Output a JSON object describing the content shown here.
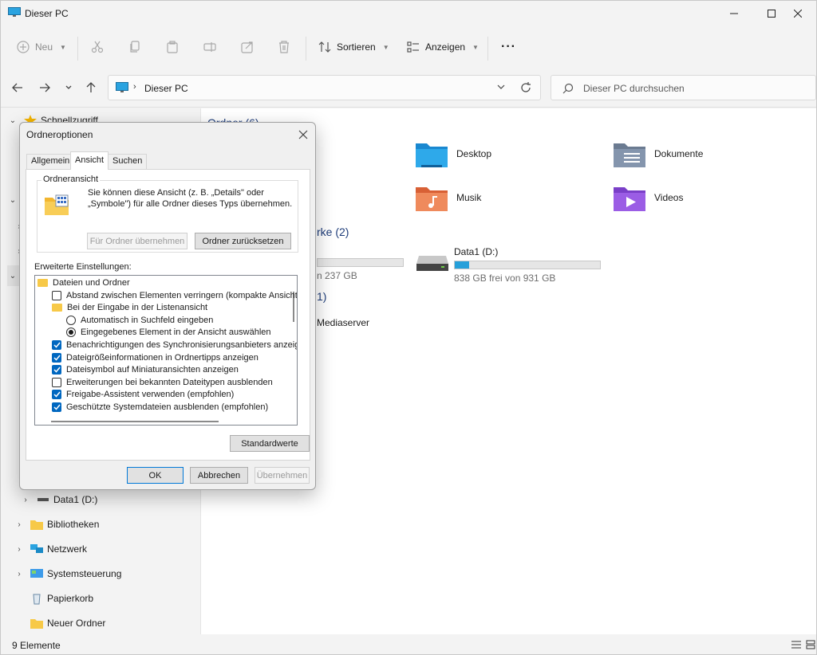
{
  "window": {
    "title": "Dieser PC"
  },
  "toolbar": {
    "new_label": "Neu",
    "sort_label": "Sortieren",
    "view_label": "Anzeigen"
  },
  "nav": {
    "address": "Dieser PC",
    "search_placeholder": "Dieser PC durchsuchen"
  },
  "sidebar": {
    "quick_access": "Schnellzugriff",
    "items": [
      {
        "label": "Data1 (D:)"
      },
      {
        "label": "Bibliotheken"
      },
      {
        "label": "Netzwerk"
      },
      {
        "label": "Systemsteuerung"
      },
      {
        "label": "Papierkorb"
      },
      {
        "label": "Neuer Ordner"
      }
    ]
  },
  "main": {
    "folders_header": "Ordner (6)",
    "folders": [
      {
        "label": "Desktop",
        "icon": "desktop-folder-icon"
      },
      {
        "label": "Dokumente",
        "icon": "documents-folder-icon"
      },
      {
        "label": "Musik",
        "icon": "music-folder-icon"
      },
      {
        "label": "Videos",
        "icon": "videos-folder-icon"
      }
    ],
    "drives_header": "rke (2)",
    "drive_c_free": "n 237 GB",
    "drive_d": {
      "name": "Data1 (D:)",
      "free": "838 GB frei von 931 GB",
      "used_fraction": 0.1
    },
    "network_header": "1)",
    "network_item": "Mediaserver"
  },
  "statusbar": {
    "count": "9 Elemente"
  },
  "dialog": {
    "title": "Ordneroptionen",
    "tabs": [
      "Allgemein",
      "Ansicht",
      "Suchen"
    ],
    "folder_view_legend": "Ordneransicht",
    "folder_view_desc": "Sie können diese Ansicht (z. B. „Details\" oder „Symbole\") für alle Ordner dieses Typs übernehmen.",
    "apply_button": "Für Ordner übernehmen",
    "reset_button": "Ordner zurücksetzen",
    "advanced_label": "Erweiterte Einstellungen:",
    "settings": [
      {
        "type": "folder",
        "label": "Dateien und Ordner",
        "indent": 0
      },
      {
        "type": "checkbox",
        "checked": false,
        "label": "Abstand zwischen Elementen verringern (kompakte Ansicht)",
        "indent": 1
      },
      {
        "type": "folder",
        "label": "Bei der Eingabe in der Listenansicht",
        "indent": 1
      },
      {
        "type": "radio",
        "checked": false,
        "label": "Automatisch in Suchfeld eingeben",
        "indent": 2
      },
      {
        "type": "radio",
        "checked": true,
        "label": "Eingegebenes Element in der Ansicht auswählen",
        "indent": 2
      },
      {
        "type": "checkbox",
        "checked": true,
        "label": "Benachrichtigungen des Synchronisierungsanbieters anzeigen",
        "indent": 1
      },
      {
        "type": "checkbox",
        "checked": true,
        "label": "Dateigrößeinformationen in Ordnertipps anzeigen",
        "indent": 1
      },
      {
        "type": "checkbox",
        "checked": true,
        "label": "Dateisymbol auf Miniaturansichten anzeigen",
        "indent": 1
      },
      {
        "type": "checkbox",
        "checked": false,
        "label": "Erweiterungen bei bekannten Dateitypen ausblenden",
        "indent": 1
      },
      {
        "type": "checkbox",
        "checked": true,
        "label": "Freigabe-Assistent verwenden (empfohlen)",
        "indent": 1
      },
      {
        "type": "checkbox",
        "checked": true,
        "label": "Geschützte Systemdateien ausblenden (empfohlen)",
        "indent": 1
      }
    ],
    "defaults_button": "Standardwerte",
    "ok_button": "OK",
    "cancel_button": "Abbrechen",
    "apply2_button": "Übernehmen"
  },
  "colors": {
    "accent": "#0067c0",
    "drive_fill": "#26a0da"
  }
}
